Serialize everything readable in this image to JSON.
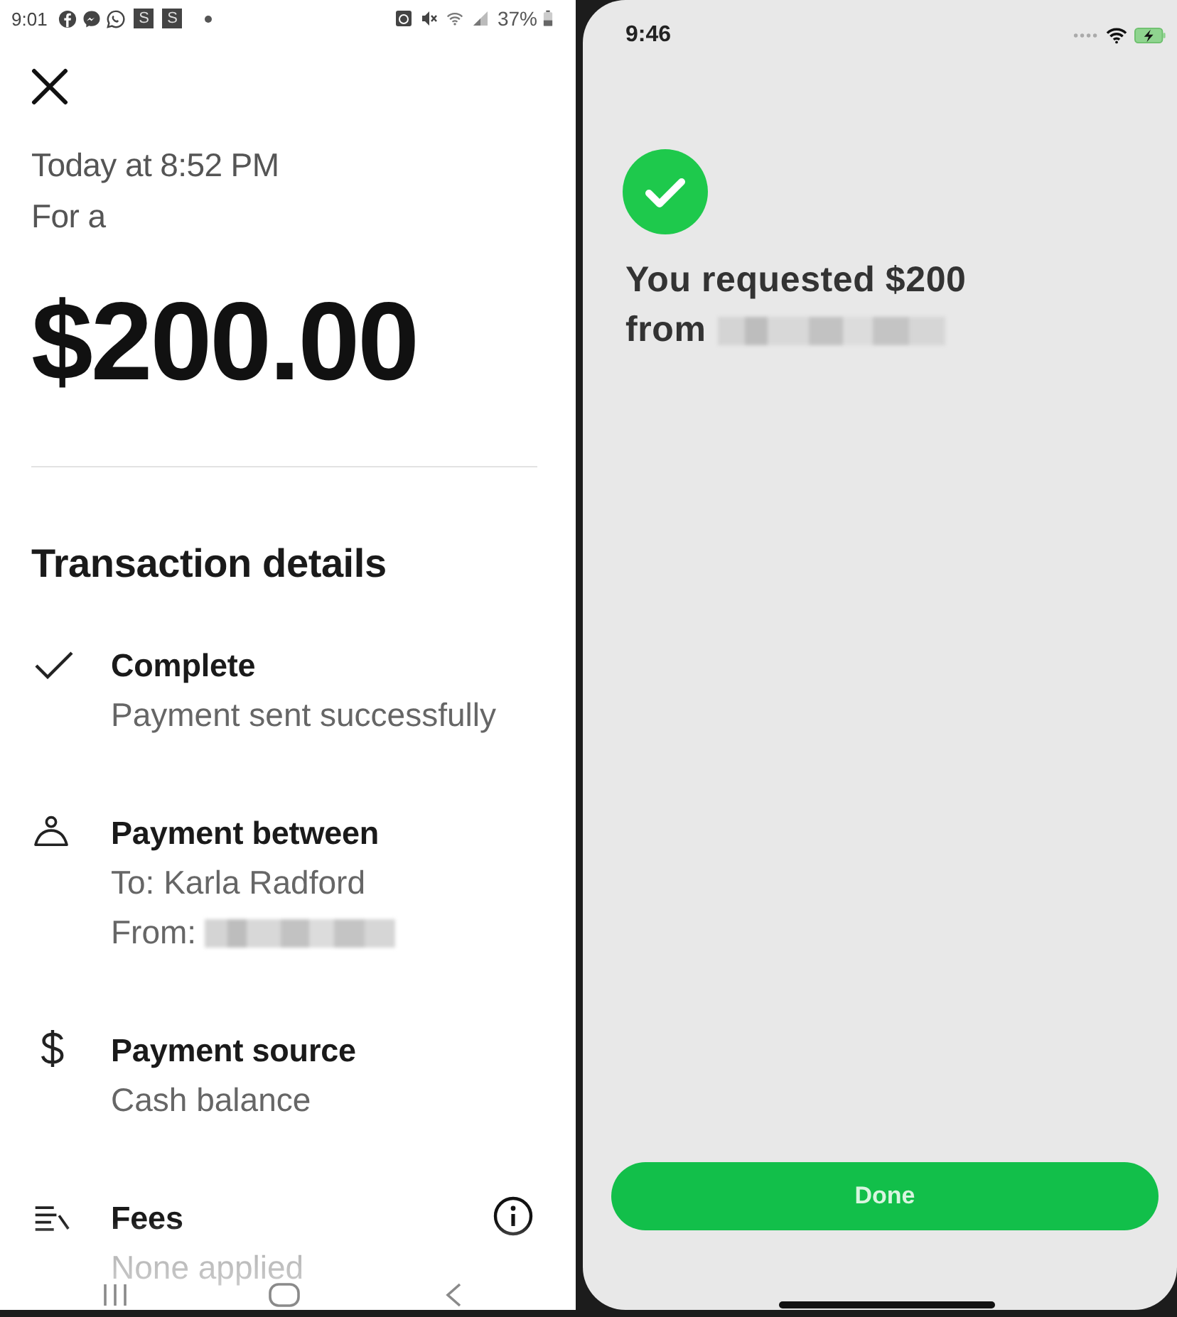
{
  "left_screen": {
    "status_bar": {
      "time": "9:01",
      "app_tiles": [
        "S",
        "S"
      ],
      "battery": "37%"
    },
    "summary": {
      "date": "Today at 8:52 PM",
      "note": "For a",
      "amount": "$200.00"
    },
    "section_title": "Transaction details",
    "details": [
      {
        "kind": "check",
        "title": "Complete",
        "lines": [
          {
            "text": "Payment sent successfully",
            "redacted": false
          }
        ],
        "info": false
      },
      {
        "kind": "person",
        "title": "Payment between",
        "lines": [
          {
            "text": "To: Karla Radford",
            "redacted": false
          },
          {
            "text": "From:",
            "redacted": true
          }
        ],
        "info": false
      },
      {
        "kind": "dollar",
        "title": "Payment source",
        "lines": [
          {
            "text": "Cash balance",
            "redacted": false
          }
        ],
        "info": false
      },
      {
        "kind": "fees",
        "title": "Fees",
        "lines": [
          {
            "text": "None applied",
            "redacted": false
          }
        ],
        "info": true
      }
    ]
  },
  "right_screen": {
    "status_bar": {
      "time": "9:46",
      "charging": true
    },
    "confirmation": {
      "lines": [
        {
          "text": "You requested $200",
          "redacted": false
        },
        {
          "text": "from",
          "redacted": true
        }
      ]
    },
    "done_button": "Done"
  }
}
